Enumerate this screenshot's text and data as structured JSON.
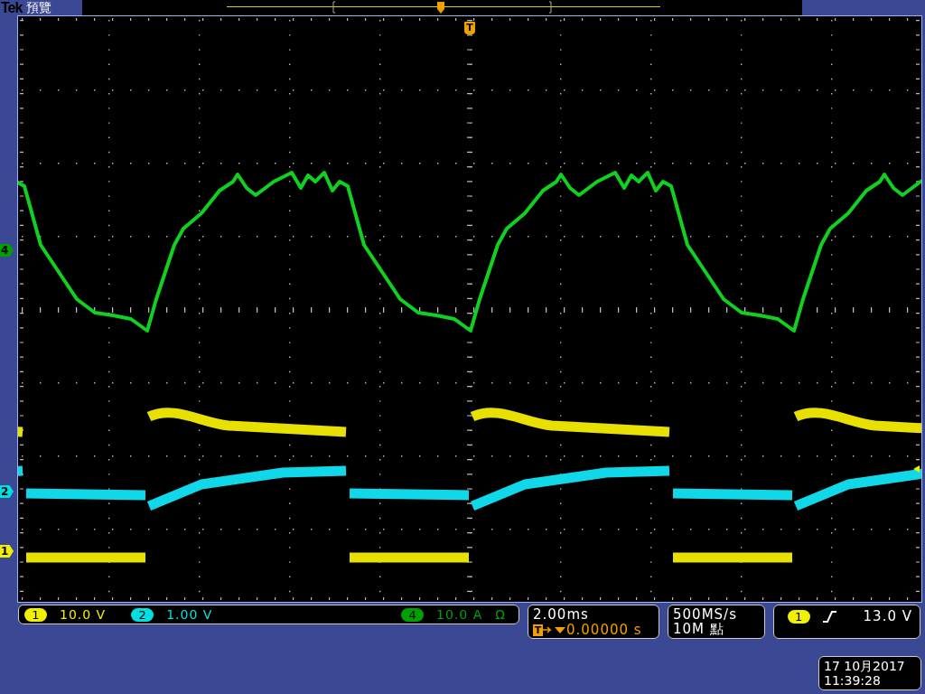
{
  "header": {
    "brand": "Tek",
    "mode": "預覽"
  },
  "trigger_position_marker": "T",
  "channel_markers": [
    {
      "label": "4",
      "color": "#00a000"
    },
    {
      "label": "2",
      "color": "#00e0e0"
    },
    {
      "label": "1",
      "color": "#f0f000"
    }
  ],
  "channels": [
    {
      "number": "1",
      "scale": "10.0 V",
      "color": "#f0f000"
    },
    {
      "number": "2",
      "scale": "1.00 V",
      "color": "#00e0e0"
    },
    {
      "number": "4",
      "scale": "10.0 A",
      "unit_symbol": "Ω",
      "color": "#00a000"
    }
  ],
  "timebase": {
    "scale": "2.00ms",
    "trigger_icon": "T",
    "delay": "0.00000 s"
  },
  "acquisition": {
    "sample_rate": "500MS/s",
    "record_length": "10M 點"
  },
  "trigger": {
    "source": "1",
    "rising_edge": true,
    "level": "13.0 V"
  },
  "datetime": {
    "date": "17 10月2017",
    "time": "11:39:28"
  }
}
